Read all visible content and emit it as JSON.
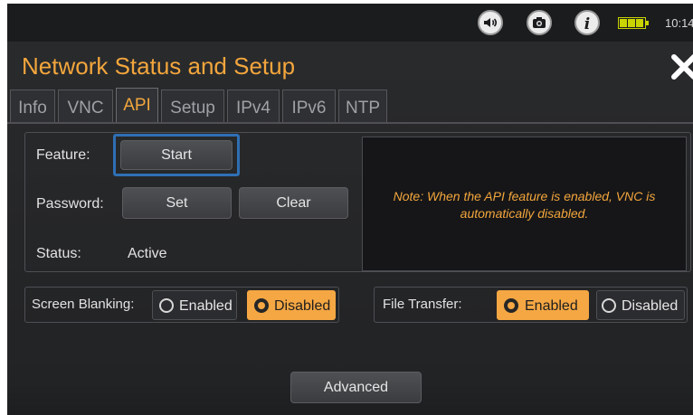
{
  "status_bar": {
    "icons": [
      "speaker-icon",
      "camera-icon",
      "info-icon",
      "battery-icon"
    ],
    "time": "10:14"
  },
  "header": {
    "title": "Network Status and Setup",
    "close_icon": "close-icon"
  },
  "tabs": [
    {
      "label": "Info",
      "active": false
    },
    {
      "label": "VNC",
      "active": false
    },
    {
      "label": "API",
      "active": true
    },
    {
      "label": "Setup",
      "active": false
    },
    {
      "label": "IPv4",
      "active": false
    },
    {
      "label": "IPv6",
      "active": false
    },
    {
      "label": "NTP",
      "active": false
    }
  ],
  "api": {
    "feature_label": "Feature:",
    "start_button": "Start",
    "password_label": "Password:",
    "set_button": "Set",
    "clear_button": "Clear",
    "status_label": "Status:",
    "status_value": "Active",
    "note": "Note: When the API feature is enabled, VNC is automatically disabled."
  },
  "screen_blanking": {
    "label": "Screen Blanking:",
    "options": [
      "Enabled",
      "Disabled"
    ],
    "selected": "Disabled"
  },
  "file_transfer": {
    "label": "File Transfer:",
    "options": [
      "Enabled",
      "Disabled"
    ],
    "selected": "Enabled"
  },
  "footer": {
    "advanced_button": "Advanced"
  },
  "colors": {
    "accent": "#f3a63c",
    "focus_border": "#2f6fb5",
    "background": "#252628"
  }
}
